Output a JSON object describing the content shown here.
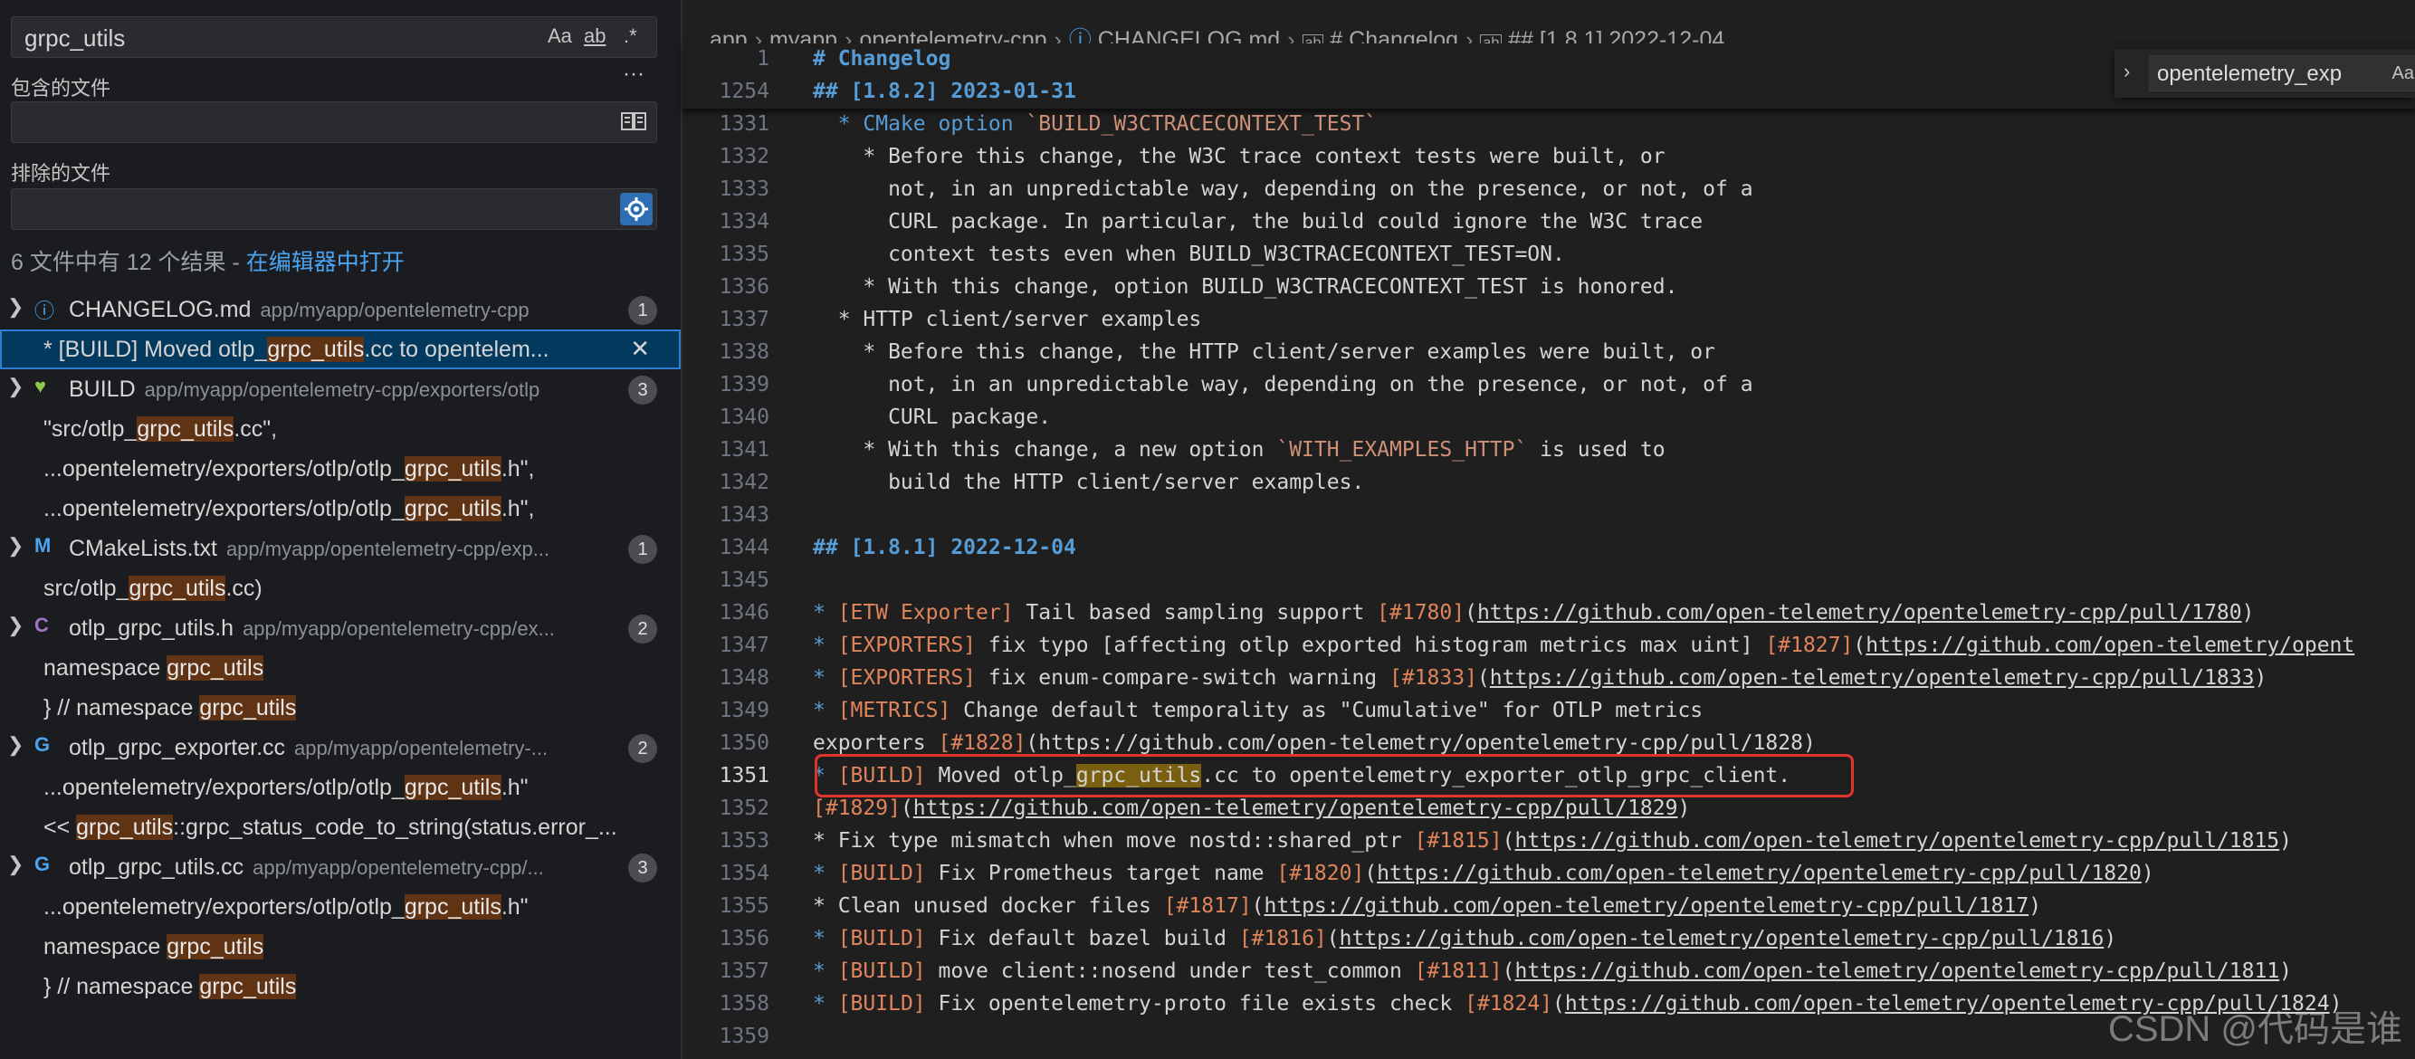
{
  "search": {
    "query": "grpc_utils",
    "opt_case": "Aa",
    "opt_word": "ab",
    "opt_regex": ".*",
    "more": "···",
    "include_label": "包含的文件",
    "include_value": "",
    "exclude_label": "排除的文件",
    "exclude_value": ""
  },
  "summary": {
    "text": "6 文件中有 12 个结果 - ",
    "link": "在编辑器中打开"
  },
  "results": {
    "f1": {
      "name": "CHANGELOG.md",
      "path": "app/myapp/opentelemetry-cpp",
      "count": "1",
      "m1": {
        "pre": "* [BUILD] Moved otlp_",
        "hit": "grpc_utils",
        "post": ".cc to opentelem...",
        "close": "✕"
      }
    },
    "f2": {
      "name": "BUILD",
      "path": "app/myapp/opentelemetry-cpp/exporters/otlp",
      "count": "3",
      "m1": {
        "pre": "\"src/otlp_",
        "hit": "grpc_utils",
        "post": ".cc\","
      },
      "m2": {
        "pre": "...opentelemetry/exporters/otlp/otlp_",
        "hit": "grpc_utils",
        "post": ".h\","
      },
      "m3": {
        "pre": "...opentelemetry/exporters/otlp/otlp_",
        "hit": "grpc_utils",
        "post": ".h\","
      }
    },
    "f3": {
      "name": "CMakeLists.txt",
      "path": "app/myapp/opentelemetry-cpp/exp...",
      "count": "1",
      "m1": {
        "pre": "src/otlp_",
        "hit": "grpc_utils",
        "post": ".cc)"
      }
    },
    "f4": {
      "name": "otlp_grpc_utils.h",
      "path": "app/myapp/opentelemetry-cpp/ex...",
      "count": "2",
      "m1": {
        "pre": "namespace ",
        "hit": "grpc_utils",
        "post": ""
      },
      "m2": {
        "pre": "}  // namespace ",
        "hit": "grpc_utils",
        "post": ""
      }
    },
    "f5": {
      "name": "otlp_grpc_exporter.cc",
      "path": "app/myapp/opentelemetry-...",
      "count": "2",
      "m1": {
        "pre": "...opentelemetry/exporters/otlp/otlp_",
        "hit": "grpc_utils",
        "post": ".h\""
      },
      "m2": {
        "pre": "<< ",
        "hit": "grpc_utils",
        "post": "::grpc_status_code_to_string(status.error_..."
      }
    },
    "f6": {
      "name": "otlp_grpc_utils.cc",
      "path": "app/myapp/opentelemetry-cpp/...",
      "count": "3",
      "m1": {
        "pre": "...opentelemetry/exporters/otlp/otlp_",
        "hit": "grpc_utils",
        "post": ".h\""
      },
      "m2": {
        "pre": "namespace ",
        "hit": "grpc_utils",
        "post": ""
      },
      "m3": {
        "pre": "}  // namespace ",
        "hit": "grpc_utils",
        "post": ""
      }
    }
  },
  "breadcrumb": {
    "c1": "app",
    "c2": "myapp",
    "c3": "opentelemetry-cpp",
    "c4": "CHANGELOG.md",
    "c5": "# Changelog",
    "c6": "## [1.8.1] 2022-12-04"
  },
  "find_widget": {
    "value": "opentelemetry_exp",
    "opt": "Aa"
  },
  "editor": {
    "l1": {
      "n": "1",
      "t": "# Changelog"
    },
    "l1254": {
      "n": "1254",
      "t": "## [1.8.2] 2023-01-31"
    },
    "l1331": {
      "n": "1331",
      "a": "  * CMake option ",
      "b": "`BUILD_W3CTRACECONTEXT_TEST`"
    },
    "l1332": {
      "n": "1332",
      "t": "    * Before this change, the W3C trace context tests were built, or"
    },
    "l1333": {
      "n": "1333",
      "t": "      not, in an unpredictable way, depending on the presence, or not, of a"
    },
    "l1334": {
      "n": "1334",
      "t": "      CURL package. In particular, the build could ignore the W3C trace"
    },
    "l1335": {
      "n": "1335",
      "t": "      context tests even when BUILD_W3CTRACECONTEXT_TEST=ON."
    },
    "l1336": {
      "n": "1336",
      "t": "    * With this change, option BUILD_W3CTRACECONTEXT_TEST is honored."
    },
    "l1337": {
      "n": "1337",
      "t": "  * HTTP client/server examples"
    },
    "l1338": {
      "n": "1338",
      "t": "    * Before this change, the HTTP client/server examples were built, or"
    },
    "l1339": {
      "n": "1339",
      "t": "      not, in an unpredictable way, depending on the presence, or not, of a"
    },
    "l1340": {
      "n": "1340",
      "t": "      CURL package."
    },
    "l1341": {
      "n": "1341",
      "a": "    * With this change, a new option ",
      "b": "`WITH_EXAMPLES_HTTP`",
      "c": " is used to"
    },
    "l1342": {
      "n": "1342",
      "t": "      build the HTTP client/server examples."
    },
    "l1343": {
      "n": "1343",
      "t": ""
    },
    "l1344": {
      "n": "1344",
      "t": "## [1.8.1] 2022-12-04"
    },
    "l1345": {
      "n": "1345",
      "t": ""
    },
    "l1346": {
      "n": "1346",
      "tag": "[ETW Exporter]",
      "a": " Tail based sampling support ",
      "ref": "[#1780]",
      "url": "https://github.com/open-telemetry/opentelemetry-cpp/pull/1780",
      "end": ")"
    },
    "l1347": {
      "n": "1347",
      "tag": "[EXPORTERS]",
      "a": " fix typo [affecting otlp exported histogram metrics max uint] ",
      "ref": "[#1827]",
      "url": "https://github.com/open-telemetry/opent",
      "end": ""
    },
    "l1348": {
      "n": "1348",
      "tag": "[EXPORTERS]",
      "a": " fix enum-compare-switch warning ",
      "ref": "[#1833]",
      "url": "https://github.com/open-telemetry/opentelemetry-cpp/pull/1833",
      "end": ")"
    },
    "l1349": {
      "n": "1349",
      "tag": "[METRICS]",
      "a": " Change default temporality as \"Cumulative\" for OTLP metrics"
    },
    "l1350": {
      "n": "1350",
      "pre": "exporters ",
      "ref": "[#1828]",
      "mid": "(https://github.com/open-telemetry/opentelemetry-cpp/pull/1828)"
    },
    "l1351": {
      "n": "1351",
      "tag": "[BUILD]",
      "a": " Moved otlp_",
      "hit": "grpc_utils",
      "b": ".cc to opentelemetry_exporter_otlp_grpc_client."
    },
    "l1352": {
      "n": "1352",
      "ref": "[#1829]",
      "url": "https://github.com/open-telemetry/opentelemetry-cpp/pull/1829",
      "end": ")"
    },
    "l1353": {
      "n": "1353",
      "a": "* Fix type mismatch when move nostd::shared_ptr ",
      "ref": "[#1815]",
      "url": "https://github.com/open-telemetry/opentelemetry-cpp/pull/1815",
      "end": ")"
    },
    "l1354": {
      "n": "1354",
      "tag": "[BUILD]",
      "a": " Fix Prometheus target name ",
      "ref": "[#1820]",
      "url": "https://github.com/open-telemetry/opentelemetry-cpp/pull/1820",
      "end": ")"
    },
    "l1355": {
      "n": "1355",
      "a": "* Clean unused docker files ",
      "ref": "[#1817]",
      "url": "https://github.com/open-telemetry/opentelemetry-cpp/pull/1817",
      "end": ")"
    },
    "l1356": {
      "n": "1356",
      "tag": "[BUILD]",
      "a": " Fix default bazel build ",
      "ref": "[#1816]",
      "url": "https://github.com/open-telemetry/opentelemetry-cpp/pull/1816",
      "end": ")"
    },
    "l1357": {
      "n": "1357",
      "tag": "[BUILD]",
      "a": " move client::nosend under test_common ",
      "ref": "[#1811]",
      "url": "https://github.com/open-telemetry/opentelemetry-cpp/pull/1811",
      "end": ")"
    },
    "l1358": {
      "n": "1358",
      "tag": "[BUILD]",
      "a": " Fix opentelemetry-proto file exists check ",
      "ref": "[#1824]",
      "url": "https://github.com/open-telemetry/opentelemetry-cpp/pull/1824",
      "end": ")"
    },
    "l1359": {
      "n": "1359",
      "t": ""
    }
  },
  "watermark": "CSDN @代码是谁",
  "colors": {
    "accent": "#4ba4f2",
    "match": "#613315",
    "selection": "#04395e",
    "redbox": "#e0352b"
  }
}
